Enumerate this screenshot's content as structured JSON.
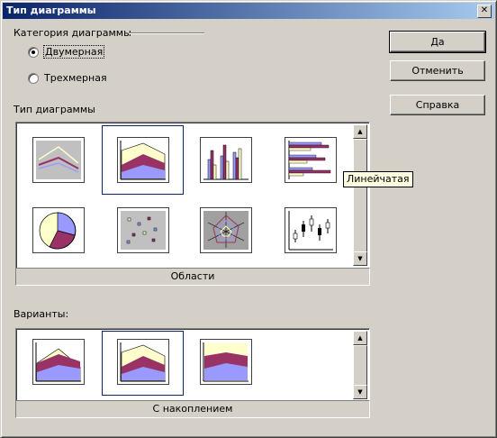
{
  "window": {
    "title": "Тип диаграммы",
    "close_label": "✕"
  },
  "category": {
    "label": "Категория диаграммы",
    "options": [
      {
        "label": "Двумерная",
        "selected": true
      },
      {
        "label": "Трехмерная",
        "selected": false
      }
    ]
  },
  "buttons": {
    "ok": "Да",
    "cancel": "Отменить",
    "help": "Справка"
  },
  "chart_type": {
    "label": "Тип диаграммы",
    "selected_name": "Области",
    "tooltip": "Линейчатая",
    "items": [
      {
        "icon": "lines-chart-icon"
      },
      {
        "icon": "area-chart-icon",
        "selected": true
      },
      {
        "icon": "bar-chart-icon"
      },
      {
        "icon": "horizontal-bar-chart-icon"
      },
      {
        "icon": "pie-chart-icon"
      },
      {
        "icon": "xy-scatter-chart-icon"
      },
      {
        "icon": "net-chart-icon"
      },
      {
        "icon": "stock-chart-icon"
      }
    ]
  },
  "variants": {
    "label": "Варианты:",
    "selected_name": "С накоплением",
    "items": [
      {
        "icon": "area-normal-icon"
      },
      {
        "icon": "area-stacked-icon",
        "selected": true
      },
      {
        "icon": "area-percent-stacked-icon"
      }
    ]
  },
  "colors": {
    "series1": "#9999ff",
    "series2": "#993366",
    "series3": "#ffffcc",
    "selection": "#0a246a"
  }
}
